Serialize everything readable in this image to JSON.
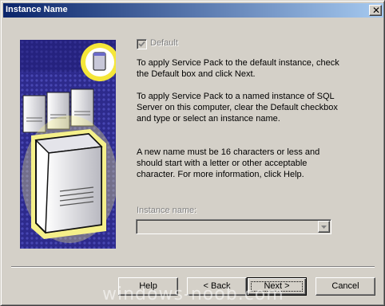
{
  "window": {
    "title": "Instance Name",
    "close_glyph": "✕"
  },
  "checkbox": {
    "label": "Default",
    "checked": true
  },
  "paragraphs": {
    "p1": "To apply Service Pack to the default instance,  check\nthe Default box and click Next.",
    "p2": "To apply Service Pack to a named instance of SQL\nServer on this computer, clear the Default checkbox\nand type or select an instance name.",
    "p3": "A new name must be 16 characters or less and\nshould start with a letter or other acceptable\ncharacter.  For more information, click Help."
  },
  "instance": {
    "label": "Instance name:",
    "value": ""
  },
  "buttons": {
    "help": "Help",
    "back": "< Back",
    "next": "Next >",
    "cancel": "Cancel"
  },
  "watermark": "windows-noob.com",
  "colors": {
    "title_start": "#0a246a",
    "title_end": "#a6caf0",
    "face": "#d4d0c8",
    "art_blue": "#2d2a8c",
    "art_glow": "#f5f08a"
  }
}
